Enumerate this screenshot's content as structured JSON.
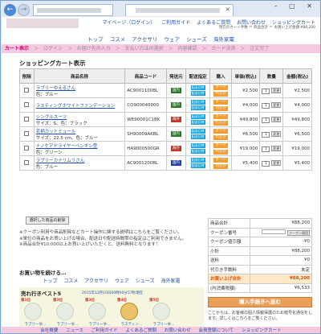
{
  "browser": {
    "back_icon": "←",
    "forward_icon": "→",
    "tab_close": "×",
    "window_controls": "– ▢ ✕"
  },
  "header": {
    "nav": [
      "マイページ（ログイン）",
      "ご利用ガイド",
      "よくあるご質問",
      "お問い合わせ",
      "ショッピングカート"
    ],
    "user_line": "現在のカート手数 ＝ 商品合計 ＝ お買い上げ金額 ¥88,200",
    "categories": [
      "トップ",
      "コスメ",
      "アクセサリ",
      "ウェア",
      "シューズ",
      "海外家電"
    ]
  },
  "steps": [
    "カート表示",
    "ログイン",
    "お届け先の入力",
    "支払い方法の選択",
    "内容確認",
    "カード決済",
    "注文完了"
  ],
  "page_title": "ショッピングカート表示",
  "table": {
    "headers": [
      "削除",
      "商品名称",
      "商品コード",
      "発送元",
      "配送指定",
      "購入",
      "単価(税込)",
      "数量",
      "金額(税込)"
    ],
    "rows": [
      {
        "name": "ラブリーゆえるさん",
        "sub": "色：ブルー",
        "code": "AC9001100BL",
        "ship": "国内",
        "ship_color": "#2a7a2a",
        "price": "¥2,500",
        "qty": "1",
        "amount": "¥2,500"
      },
      {
        "name": "ラスティングホワイトファンデーション",
        "sub": "",
        "code": "CO900040000",
        "ship": "国内",
        "ship_color": "#2a7a2a",
        "price": "¥4,000",
        "qty": "1",
        "amount": "¥4,000"
      },
      {
        "name": "シングルスーツ",
        "sub": "サイズ：S、色：ブラック",
        "code": "WE90001C1BK",
        "ship": "海外",
        "ship_color": "#c0392b",
        "price": "¥49,800",
        "qty": "1",
        "amount": "¥49,800"
      },
      {
        "name": "花柄カットミュール",
        "sub": "サイズ：22.5 cm、色：ブルー",
        "code": "SH90009AKBL",
        "ship": "国内",
        "ship_color": "#2a7a2a",
        "price": "¥6,500",
        "qty": "1",
        "amount": "¥6,500"
      },
      {
        "name": "ナノケアドライヤーペンギン型",
        "sub": "色：グリーン",
        "code": "HA9000500GR",
        "ship": "海外",
        "ship_color": "#c0392b",
        "price": "¥19,000",
        "qty": "1",
        "amount": "¥19,000"
      },
      {
        "name": "ラブリーカナリムリさん",
        "sub": "色：ブルー",
        "code": "AC9001200BL",
        "ship": "国内",
        "ship_color": "#1e3fa8",
        "price": "¥5,400",
        "qty": "1",
        "amount": "¥5,400"
      }
    ],
    "sched_label": "配送日時",
    "cc_label": "カード",
    "cc_label2": "代引き",
    "change_label": "変更"
  },
  "delete_button": "選択した商品の削除",
  "notes": {
    "line1": "※クーポン利用や商品削除などカート操作に関する説明はこちらをご覧ください。",
    "line2": "※単位の商品をお買い上げの場合、配送日や配送時間帯の指定はご利用できません。",
    "line3": "※商品合計¥10,000以上お買い上げいただくと、送料無料となります！"
  },
  "shopping_more": "お買い物を続ける…",
  "ranking": {
    "title": "売れ行きベスト5",
    "date": "2015年12月10日00時00分57秒現在",
    "items": [
      {
        "rank": "第1位",
        "name": "ラブリーゆ…"
      },
      {
        "rank": "第2位",
        "name": "ラブリーゆ…"
      },
      {
        "rank": "第3位",
        "name": "ラブリーゆ…"
      },
      {
        "rank": "第4位",
        "name": "ラスティン…"
      },
      {
        "rank": "第5位",
        "name": "ラブリーゆ…"
      }
    ]
  },
  "summary": {
    "rows": [
      {
        "label": "商品合計",
        "value": "¥88,200"
      },
      {
        "label": "クーポン番号",
        "value": ""
      },
      {
        "label": "クーポン値引額",
        "value": "-¥0"
      },
      {
        "label": "小計",
        "value": "¥88,200"
      },
      {
        "label": "送料",
        "value": "¥0"
      },
      {
        "label": "代引き手数料",
        "value": "未定"
      },
      {
        "label": "お買い上げ合計",
        "value": "¥88,200"
      },
      {
        "label": "(内消費税額)",
        "value": "¥6,533"
      }
    ],
    "coupon_button": "クーポン適用",
    "checkout": "購入手続きへ進む",
    "note": "ここからは、お客様の個人情報保護のため暗号化通信をします。詳しくはこちらをご覧ください。",
    "note_link": "こちら"
  },
  "footer": [
    "会社概要",
    "ニュース",
    "ご利用ガイド",
    "よくあるご質問",
    "お問い合わせ",
    "会員登録について",
    "ショッピングカート"
  ]
}
